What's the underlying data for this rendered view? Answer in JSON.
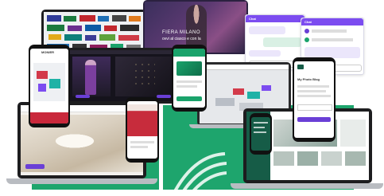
{
  "banner": {
    "title_line1": "FIERA MILANO",
    "title_line2": "ovvi al ciasco e con la"
  },
  "chat_left": {
    "title": "Chat"
  },
  "chat_right": {
    "title": "Chat"
  },
  "phone_left": {
    "title": "MONIER"
  },
  "phone_right_top": {
    "title": "My Photo Blog"
  },
  "colors": {
    "accent_green": "#1ea56d",
    "accent_purple": "#6a3fd6",
    "dark": "#1d1d1f"
  }
}
